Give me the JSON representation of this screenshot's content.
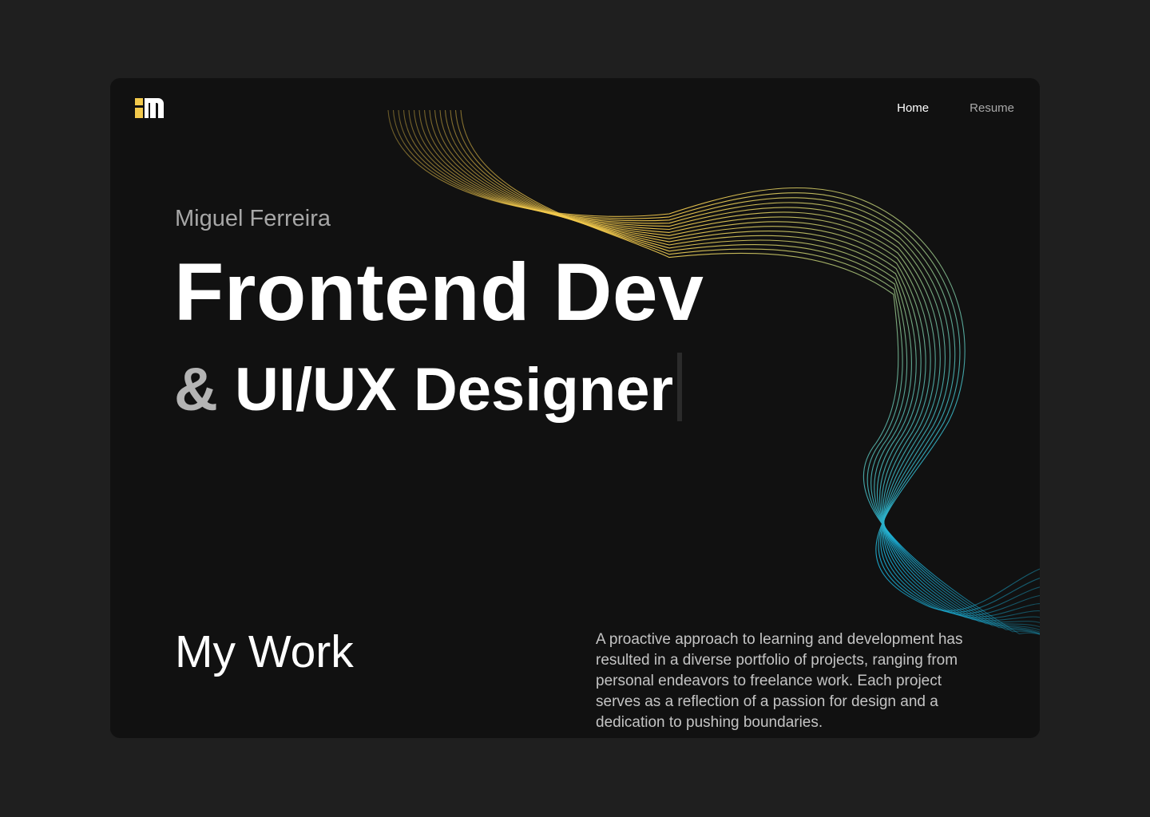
{
  "colors": {
    "page_bg": "#1f1f1f",
    "card_bg": "#111111",
    "accent_yellow": "#f2c94c",
    "accent_cyan": "#1ab0d8"
  },
  "logo": {
    "icon": "m-logo-icon"
  },
  "nav": {
    "items": [
      {
        "label": "Home",
        "active": true
      },
      {
        "label": "Resume",
        "active": false
      }
    ]
  },
  "hero": {
    "name": "Miguel Ferreira",
    "title": "Frontend Dev",
    "subtitle_amp": "&",
    "subtitle_rest": "UI/UX Designer"
  },
  "work": {
    "title": "My Work",
    "description": "A proactive approach to learning and development has resulted in a diverse portfolio of projects, ranging from personal endeavors to freelance work. Each project serves as a reflection of a passion for design and a dedication to pushing boundaries."
  }
}
